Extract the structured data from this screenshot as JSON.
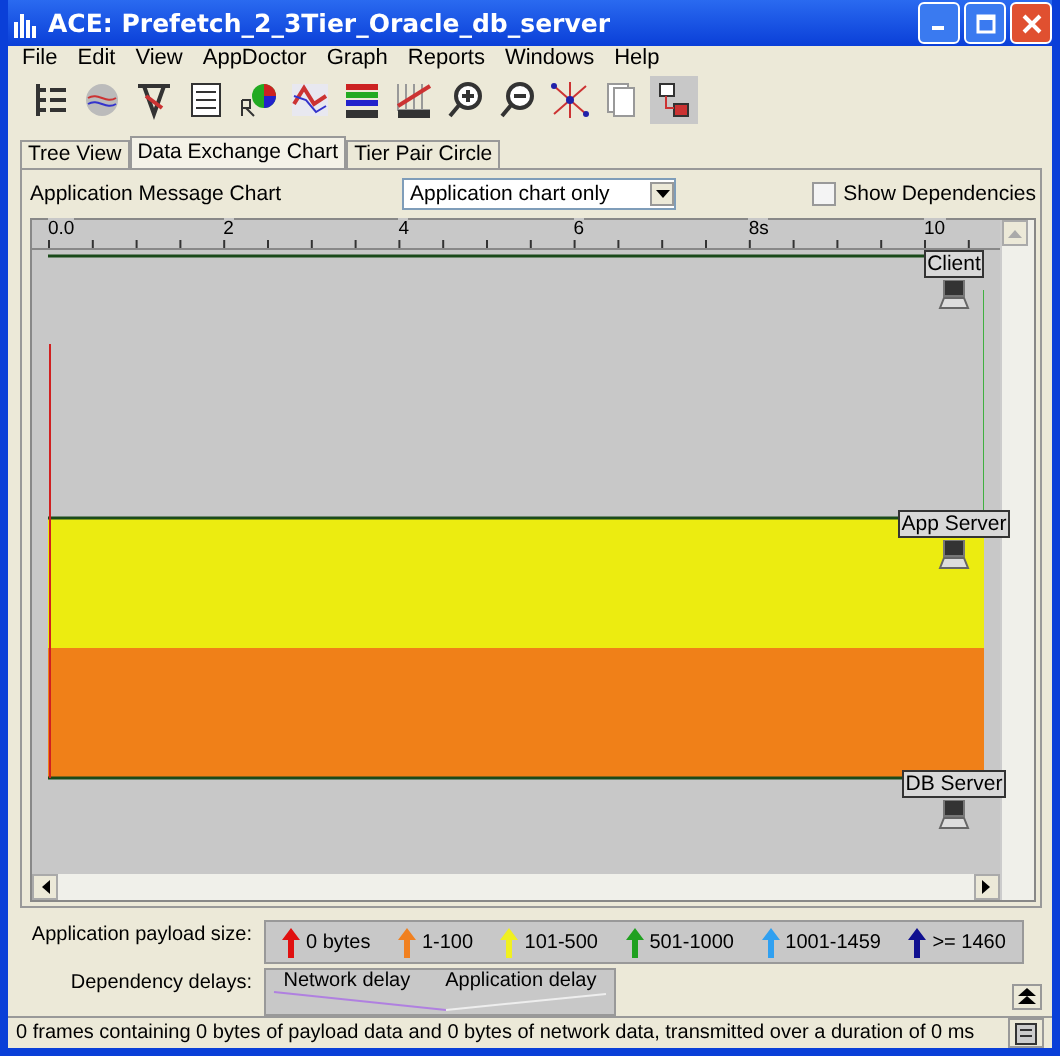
{
  "window": {
    "title": "ACE: Prefetch_2_3Tier_Oracle_db_server"
  },
  "menu": [
    "File",
    "Edit",
    "View",
    "AppDoctor",
    "Graph",
    "Reports",
    "Windows",
    "Help"
  ],
  "tabs": [
    {
      "label": "Tree View",
      "selected": false
    },
    {
      "label": "Data Exchange Chart",
      "selected": true
    },
    {
      "label": "Tier Pair Circle",
      "selected": false
    }
  ],
  "chart_header": {
    "title": "Application Message Chart",
    "view_select": "Application chart only",
    "show_dependencies": {
      "label": "Show Dependencies",
      "checked": false
    }
  },
  "ruler_labels": [
    "0.0",
    "2",
    "4",
    "6",
    "8s",
    "10"
  ],
  "tiers": [
    "Client",
    "App Server",
    "DB Server"
  ],
  "legend": {
    "label": "Application payload size:",
    "items": [
      {
        "label": "0 bytes",
        "color": "#e01010"
      },
      {
        "label": "1-100",
        "color": "#f08020"
      },
      {
        "label": "101-500",
        "color": "#f0f020"
      },
      {
        "label": "501-1000",
        "color": "#20a020"
      },
      {
        "label": "1001-1459",
        "color": "#30a0f0"
      },
      {
        "label": ">= 1460",
        "color": "#101090"
      }
    ]
  },
  "delays": {
    "label": "Dependency delays:",
    "items": [
      "Network delay",
      "Application delay"
    ]
  },
  "status_bar": "0 frames containing 0 bytes of payload data and 0 bytes of network data, transmitted over a duration of 0 ms"
}
